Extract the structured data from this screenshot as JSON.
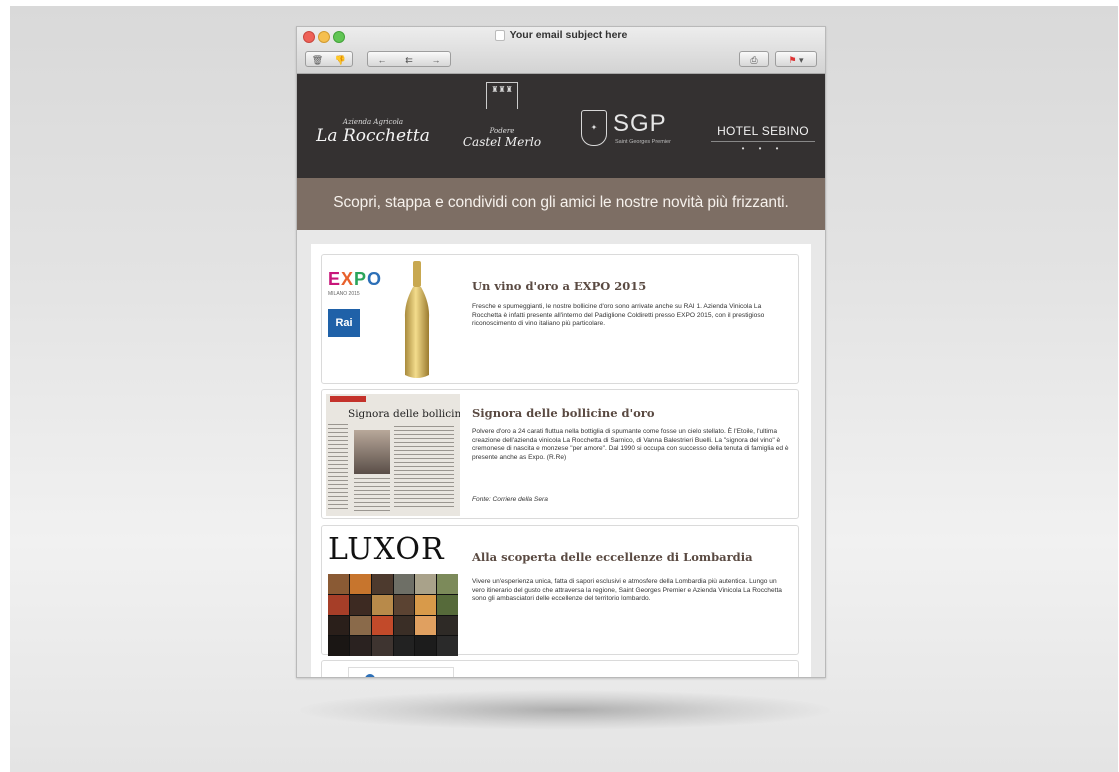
{
  "window": {
    "title": "Your email subject here",
    "toolbar": {
      "delete_icon": "trash-icon",
      "junk_icon": "thumbs-down-icon",
      "reply_icon": "reply-icon",
      "reply_all_icon": "reply-all-icon",
      "forward_icon": "forward-icon",
      "print_icon": "printer-icon",
      "flag_icon": "flag-icon"
    }
  },
  "header": {
    "logos": {
      "rocchetta_small": "Azienda Agricola",
      "rocchetta_big": "La Rocchetta",
      "castel_small": "Podere",
      "castel_big": "Castel Merlo",
      "sgp_letters": "SGP",
      "sgp_sub": "Saint Georges Premier",
      "hotel_name": "HOTEL SEBINO",
      "hotel_stars": "• • •"
    },
    "tagline": "Scopri, stappa e condividi con gli amici le nostre novità più frizzanti."
  },
  "articles": [
    {
      "title": "Un vino d'oro a EXPO 2015",
      "text": "Fresche e spumeggianti, le nostre bollicine d'oro sono arrivate anche su RAI 1. Azienda Vinicola La Rocchetta è infatti presente all'interno del Padiglione Coldiretti presso EXPO 2015, con il prestigioso riconoscimento di vino italiano più particolare.",
      "thumb": {
        "expo": "EXPO",
        "expo_sub": "MILANO 2015",
        "rai": "Rai"
      }
    },
    {
      "title": "Signora delle bollicine d'oro",
      "text": "Polvere d'oro a 24 carati fluttua nella bottiglia di spumante come fosse un cielo stellato. È l'Etoile, l'ultima creazione dell'azienda vinicola La Rocchetta di Sarnico, di Vanna Balestrieri Buelli. La \"signora del vino\" è cremonese di nascita e monzese \"per amore\". Dal 1990 si occupa con successo della tenuta di famiglia ed è presente anche as Expo. (R.Re)",
      "source": "Fonte: Corriere della Sera",
      "thumb": {
        "headline": "Signora delle bollicine d'o"
      }
    },
    {
      "title": "Alla scoperta delle eccellenze di Lombardia",
      "text": "Vivere un'esperienza unica, fatta di sapori esclusivi e atmosfere della Lombardia più autentica. Lungo un vero itinerario del gusto che attraversa la regione, Saint Georges Premier e Azienda Vinicola La Rocchetta sono gli ambasciatori delle eccellenze del territorio lombardo.",
      "thumb": {
        "word": "LUXOR"
      }
    }
  ]
}
